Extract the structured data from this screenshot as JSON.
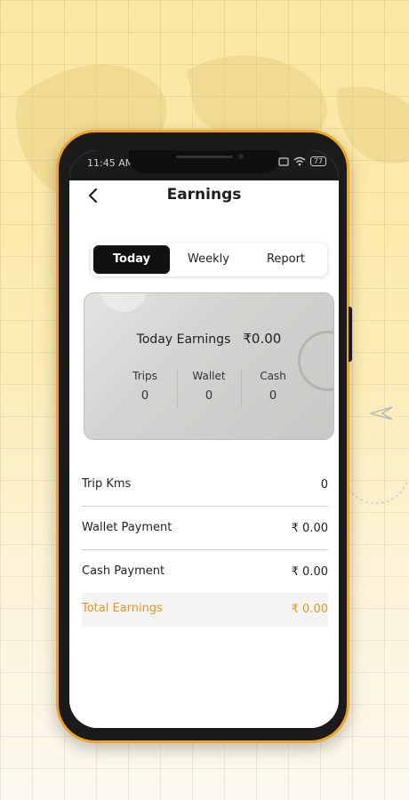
{
  "status_bar": {
    "time": "11:45 AM",
    "battery": "77"
  },
  "header": {
    "title": "Earnings"
  },
  "tabs": [
    {
      "label": "Today",
      "active": true
    },
    {
      "label": "Weekly",
      "active": false
    },
    {
      "label": "Report",
      "active": false
    }
  ],
  "summary_card": {
    "title": "Today Earnings",
    "amount": "₹0.00",
    "stats": [
      {
        "label": "Trips",
        "value": "0"
      },
      {
        "label": "Wallet",
        "value": "0"
      },
      {
        "label": "Cash",
        "value": "0"
      }
    ]
  },
  "rows": [
    {
      "label": "Trip Kms",
      "value": "0"
    },
    {
      "label": "Wallet Payment",
      "value": "₹ 0.00"
    },
    {
      "label": "Cash Payment",
      "value": "₹ 0.00"
    }
  ],
  "total": {
    "label": "Total Earnings",
    "value": "₹ 0.00"
  },
  "colors": {
    "accent": "#f0a623",
    "total_text": "#e09a1e",
    "active_tab_bg": "#111111"
  },
  "icons": {
    "back": "chevron-left-icon",
    "wifi": "wifi-icon",
    "battery": "battery-icon"
  }
}
